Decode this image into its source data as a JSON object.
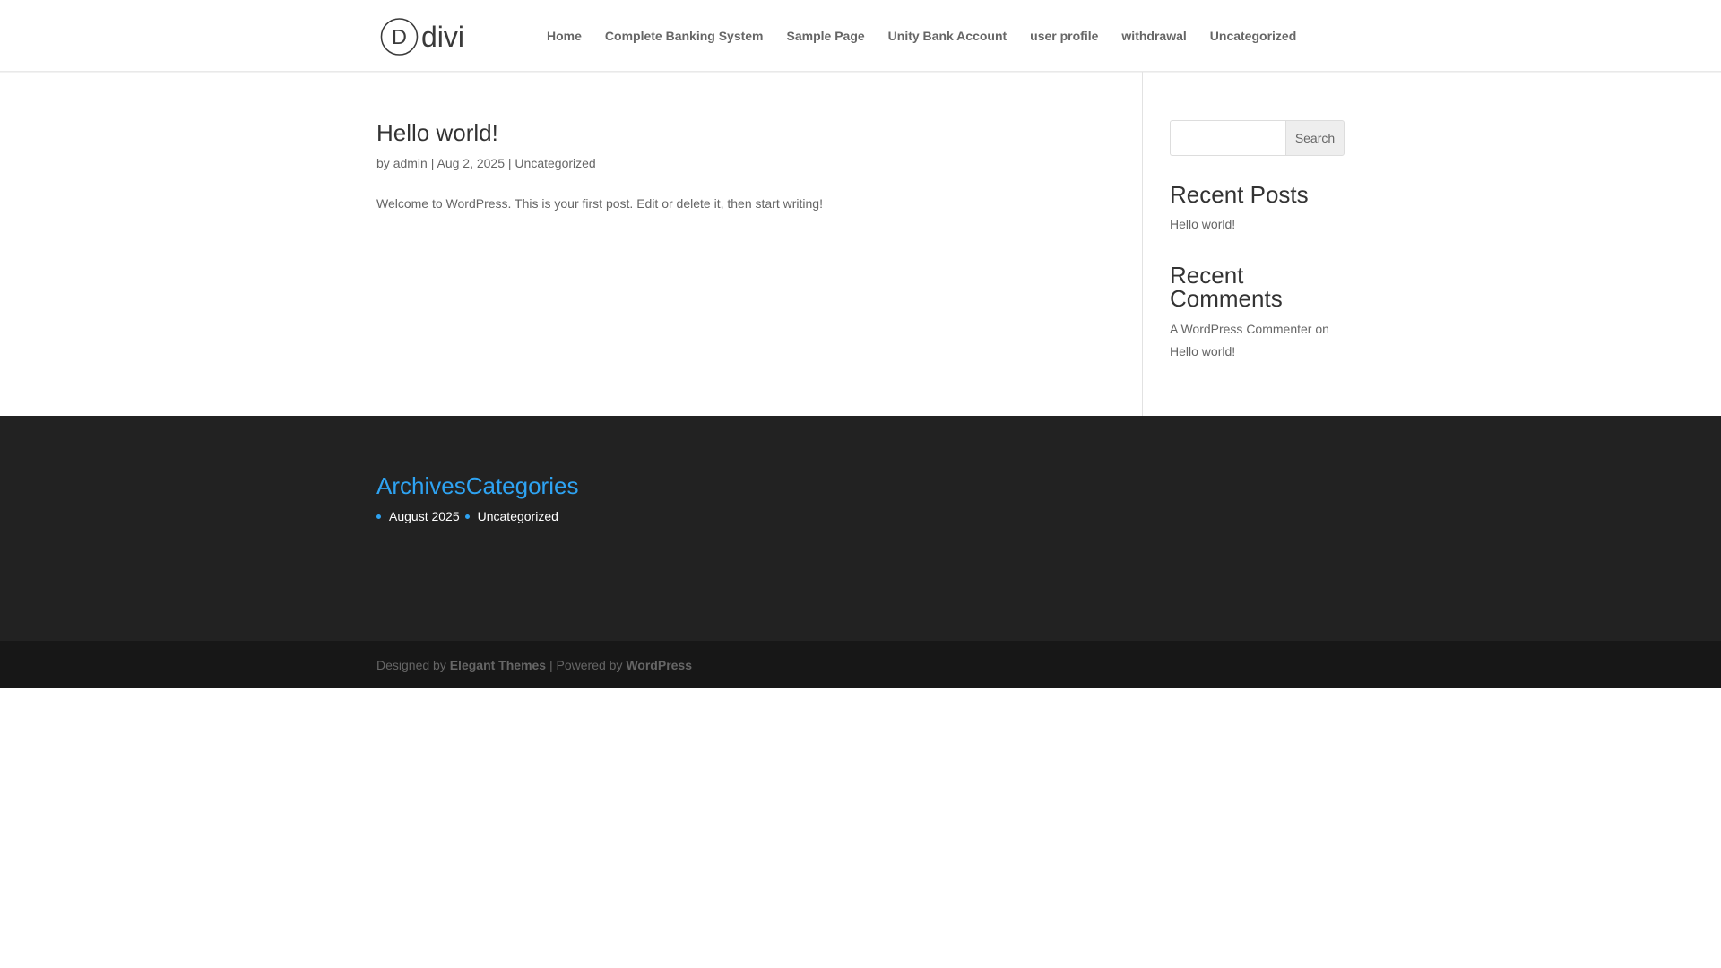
{
  "header": {
    "logo_text": "divi",
    "logo_letter": "D",
    "nav": [
      {
        "label": "Home"
      },
      {
        "label": "Complete Banking System"
      },
      {
        "label": "Sample Page"
      },
      {
        "label": "Unity Bank Account"
      },
      {
        "label": "user profile"
      },
      {
        "label": "withdrawal"
      },
      {
        "label": "Uncategorized"
      }
    ]
  },
  "post": {
    "title": "Hello world!",
    "meta_prefix": "by",
    "author": "admin",
    "separator": "|",
    "date": "Aug 2, 2025",
    "category": "Uncategorized",
    "excerpt": "Welcome to WordPress. This is your first post. Edit or delete it, then start writing!"
  },
  "sidebar": {
    "search_placeholder": "",
    "search_button": "Search",
    "recent_posts_title": "Recent Posts",
    "recent_posts": [
      "Hello world!"
    ],
    "recent_comments_title": "Recent Comments",
    "comment_author": "A WordPress Commenter",
    "comment_on": "on",
    "comment_post": "Hello world!"
  },
  "footer": {
    "archives_title": "Archives",
    "categories_title": "Categories",
    "archive_item": "August 2025",
    "category_item": "Uncategorized"
  },
  "credits": {
    "designed_by": "Designed by",
    "elegant_themes": "Elegant Themes",
    "separator": "| Powered by",
    "wordpress": "WordPress"
  },
  "colors": {
    "accent": "#2ea3f2",
    "footer_bg": "#222222",
    "bottom_bar_bg": "#171717",
    "text": "#666666",
    "heading": "#333333"
  }
}
